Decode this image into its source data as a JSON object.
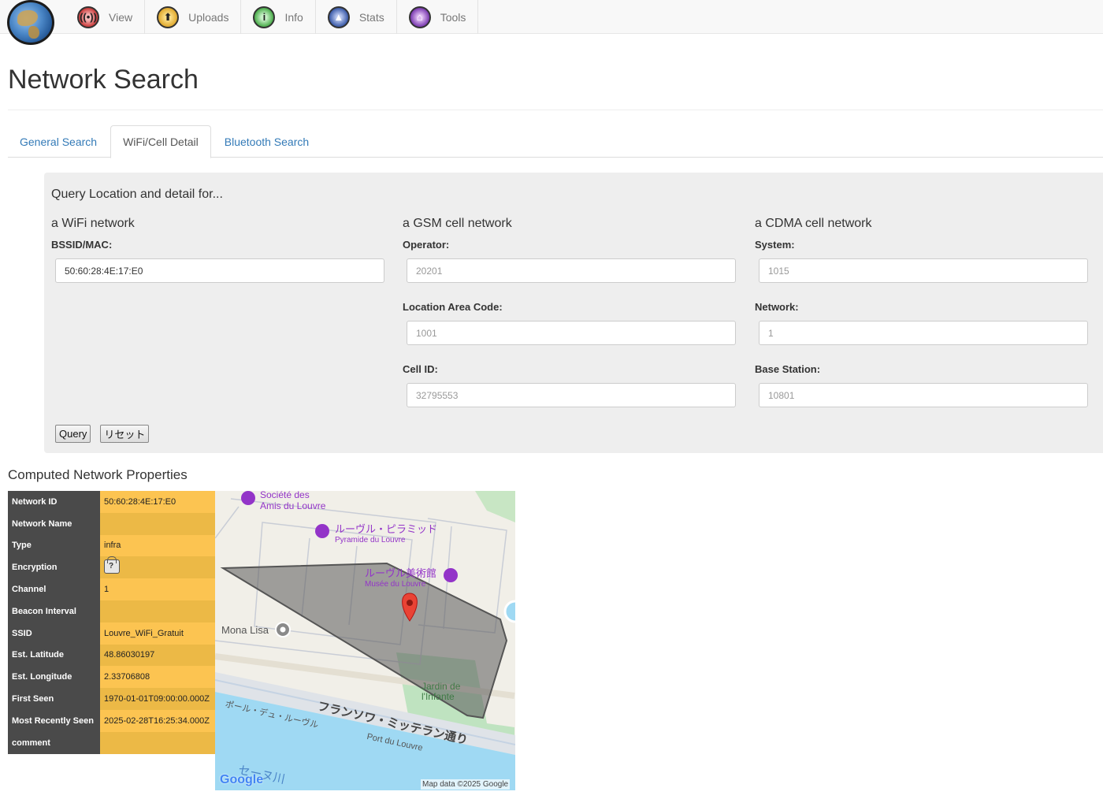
{
  "nav": {
    "items": [
      {
        "label": "View",
        "icon": "antenna-icon",
        "color": "#c93a3a"
      },
      {
        "label": "Uploads",
        "icon": "upload-icon",
        "color": "#e0a92e"
      },
      {
        "label": "Info",
        "icon": "info-icon",
        "color": "#4cae4c"
      },
      {
        "label": "Stats",
        "icon": "stats-icon",
        "color": "#3a5aa8"
      },
      {
        "label": "Tools",
        "icon": "tools-icon",
        "color": "#7a3ab0"
      }
    ]
  },
  "page": {
    "title": "Network Search"
  },
  "tabs": [
    {
      "label": "General Search"
    },
    {
      "label": "WiFi/Cell Detail"
    },
    {
      "label": "Bluetooth Search"
    }
  ],
  "query": {
    "title": "Query Location and detail for...",
    "wifi": {
      "heading": "a WiFi network",
      "bssid_label": "BSSID/MAC:",
      "bssid_value": "50:60:28:4E:17:E0"
    },
    "gsm": {
      "heading": "a GSM cell network",
      "operator_label": "Operator:",
      "operator_placeholder": "20201",
      "lac_label": "Location Area Code:",
      "lac_placeholder": "1001",
      "cellid_label": "Cell ID:",
      "cellid_placeholder": "32795553"
    },
    "cdma": {
      "heading": "a CDMA cell network",
      "system_label": "System:",
      "system_placeholder": "1015",
      "network_label": "Network:",
      "network_placeholder": "1",
      "basestation_label": "Base Station:",
      "basestation_placeholder": "10801"
    },
    "query_button": "Query",
    "reset_button": "リセット"
  },
  "properties": {
    "title": "Computed Network Properties",
    "rows": [
      {
        "key": "Network ID",
        "value": "50:60:28:4E:17:E0"
      },
      {
        "key": "Network Name",
        "value": ""
      },
      {
        "key": "Type",
        "value": "infra"
      },
      {
        "key": "Encryption",
        "value": ""
      },
      {
        "key": "Channel",
        "value": "1"
      },
      {
        "key": "Beacon Interval",
        "value": ""
      },
      {
        "key": "SSID",
        "value": "Louvre_WiFi_Gratuit"
      },
      {
        "key": "Est. Latitude",
        "value": "48.86030197"
      },
      {
        "key": "Est. Longitude",
        "value": "2.33706808"
      },
      {
        "key": "First Seen",
        "value": "1970-01-01T09:00:00.000Z"
      },
      {
        "key": "Most Recently Seen",
        "value": "2025-02-28T16:25:34.000Z"
      },
      {
        "key": "comment",
        "value": ""
      }
    ]
  },
  "map": {
    "labels": {
      "societe": "Société des",
      "societe2": "Amis du Louvre",
      "pyramide": "ルーヴル・ピラミッド",
      "pyramide_sub": "Pyramide du Louvre",
      "musee": "ルーヴル美術館",
      "musee_sub": "Musée du Louvre",
      "mona": "Mona Lisa",
      "jardin": "Jardin de",
      "jardin2": "l'Infante",
      "port_jp": "ポール・デュ・ルーヴル",
      "quai": "フランソワ・ミッテラン通り",
      "port": "Port du Louvre",
      "seine": "セーヌ川",
      "google": "Google",
      "attribution": "Map data ©2025 Google"
    }
  }
}
